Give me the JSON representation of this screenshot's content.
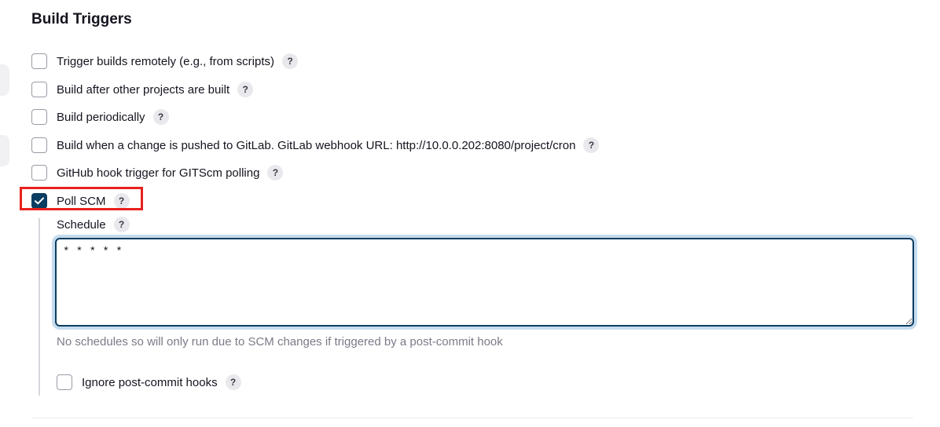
{
  "section": {
    "title": "Build Triggers"
  },
  "triggers": [
    {
      "label": "Trigger builds remotely (e.g., from scripts)",
      "checked": false
    },
    {
      "label": "Build after other projects are built",
      "checked": false
    },
    {
      "label": "Build periodically",
      "checked": false
    },
    {
      "label": "Build when a change is pushed to GitLab. GitLab webhook URL: http://10.0.0.202:8080/project/cron",
      "checked": false
    },
    {
      "label": "GitHub hook trigger for GITScm polling",
      "checked": false
    },
    {
      "label": "Poll SCM",
      "checked": true
    }
  ],
  "help_glyph": "?",
  "poll_scm": {
    "schedule_label": "Schedule",
    "schedule_value": "* * * * *",
    "hint": "No schedules so will only run due to SCM changes if triggered by a post-commit hook",
    "ignore_hooks_label": "Ignore post-commit hooks",
    "ignore_hooks_checked": false
  },
  "colors": {
    "accent": "#0a3d62",
    "highlight": "#e8211d",
    "focus_ring": "#c6dcee",
    "muted_text": "#7b7b88"
  }
}
